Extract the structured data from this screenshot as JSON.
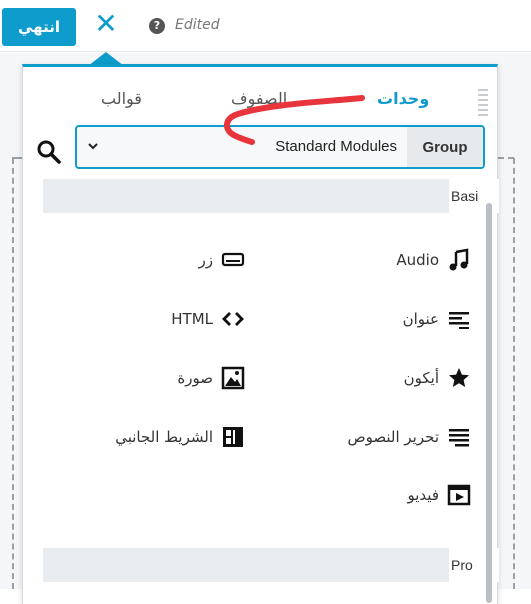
{
  "toolbar": {
    "done_label": "انتهي",
    "close_glyph": "✕",
    "help_glyph": "?",
    "status_text": "Edited"
  },
  "tabs": [
    {
      "label": "وحدات",
      "active": true
    },
    {
      "label": "الصفوف",
      "active": false
    },
    {
      "label": "قوالب",
      "active": false
    }
  ],
  "group_select": {
    "label": "Group",
    "value": "Standard Modules"
  },
  "sections": {
    "basic": "Basi",
    "pro": "Pro"
  },
  "modules": {
    "right": [
      {
        "label": "Audio",
        "icon": "music-note-icon"
      },
      {
        "label": "عنوان",
        "icon": "heading-lines-icon"
      },
      {
        "label": "أيكون",
        "icon": "star-icon"
      },
      {
        "label": "تحرير النصوص",
        "icon": "text-editor-icon"
      },
      {
        "label": "فيديو",
        "icon": "video-icon"
      }
    ],
    "left": [
      {
        "label": "زر",
        "icon": "button-icon"
      },
      {
        "label": "HTML",
        "icon": "code-icon"
      },
      {
        "label": "صورة",
        "icon": "image-icon"
      },
      {
        "label": "الشريط الجانبي",
        "icon": "sidebar-icon"
      }
    ]
  },
  "colors": {
    "accent": "#0e9ccc",
    "annotation": "#e8353b"
  }
}
